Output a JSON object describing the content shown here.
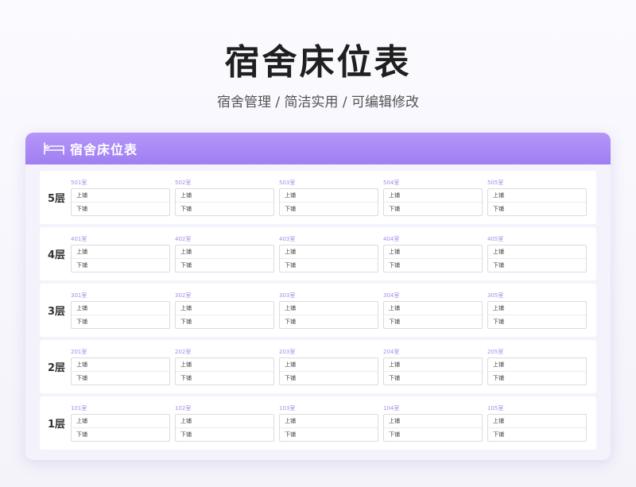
{
  "header": {
    "title": "宿舍床位表",
    "subtitle": "宿舍管理 / 简洁实用 /  可编辑修改"
  },
  "card": {
    "title": "宿舍床位表",
    "icon": "bed-icon",
    "accent_color": "#a584f5"
  },
  "bunk_labels": {
    "upper": "上铺",
    "lower": "下铺"
  },
  "floors": [
    {
      "label": "5层",
      "rooms": [
        "501室",
        "502室",
        "503室",
        "504室",
        "505室"
      ]
    },
    {
      "label": "4层",
      "rooms": [
        "401室",
        "402室",
        "403室",
        "404室",
        "405室"
      ]
    },
    {
      "label": "3层",
      "rooms": [
        "301室",
        "302室",
        "303室",
        "304室",
        "305室"
      ]
    },
    {
      "label": "2层",
      "rooms": [
        "201室",
        "202室",
        "203室",
        "204室",
        "205室"
      ]
    },
    {
      "label": "1层",
      "rooms": [
        "101室",
        "102室",
        "103室",
        "104室",
        "105室"
      ]
    }
  ]
}
